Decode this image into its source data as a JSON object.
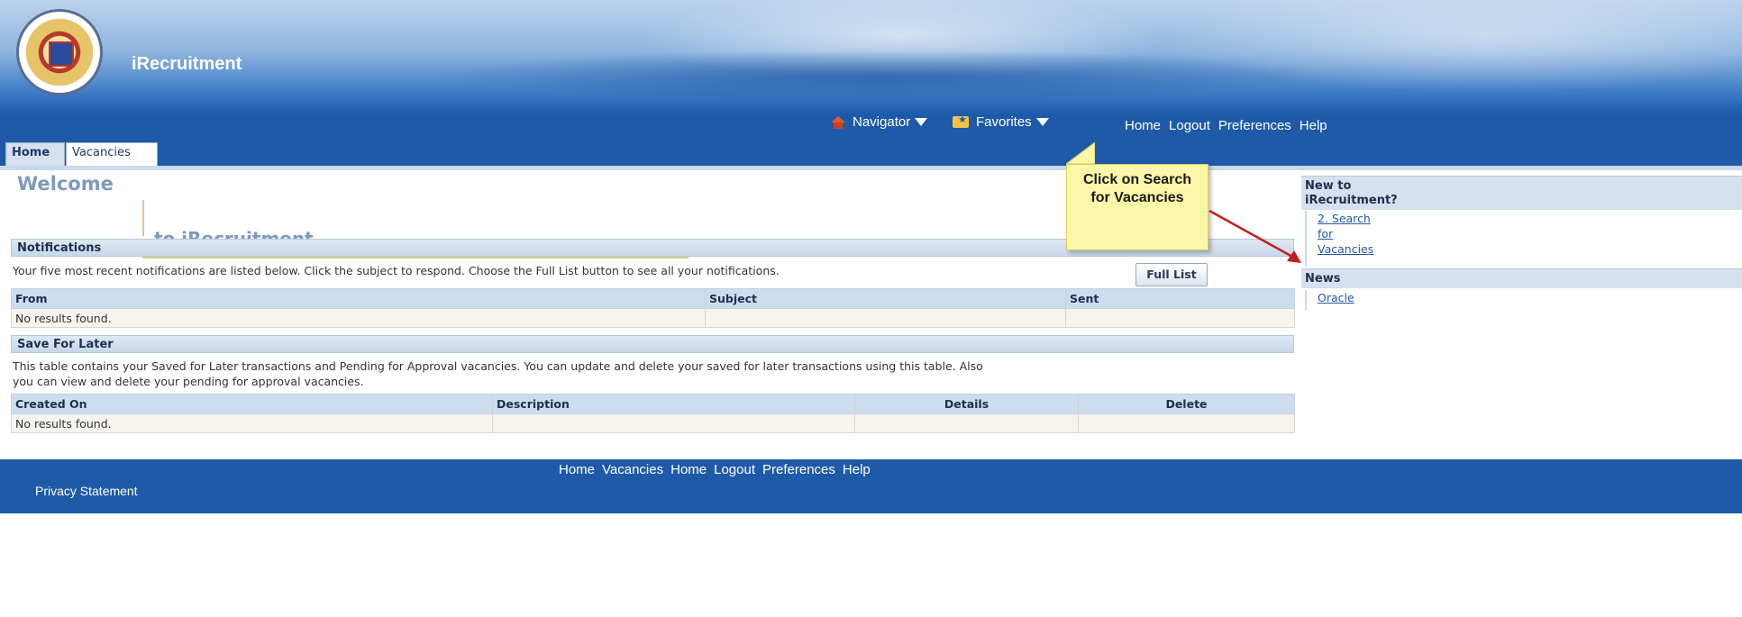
{
  "app": {
    "title": "iRecruitment"
  },
  "header": {
    "navigator_label": "Navigator",
    "favorites_label": "Favorites",
    "global_links": [
      "Home",
      "Logout",
      "Preferences",
      "Help"
    ]
  },
  "tabs": [
    {
      "label": "Home",
      "selected": true
    },
    {
      "label": "Vacancies",
      "selected": false
    }
  ],
  "welcome": {
    "title": "Welcome",
    "subtitle": "to iRecruitment"
  },
  "notifications": {
    "header": "Notifications",
    "instruction": "Your five most recent notifications are listed below. Click the subject to respond. Choose the Full List button to see all your notifications.",
    "full_list_button": "Full List",
    "columns": [
      "From",
      "Subject",
      "Sent"
    ],
    "empty_text": "No results found."
  },
  "save_for_later": {
    "header": "Save For Later",
    "instruction_line1": "This table contains your Saved for Later transactions and Pending for Approval vacancies. You can update and delete your saved for later transactions using this table. Also",
    "instruction_line2": "you can view and delete your pending for approval vacancies.",
    "columns": [
      "Created On",
      "Description",
      "Details",
      "Delete"
    ],
    "empty_text": "No results found."
  },
  "callout": {
    "line1": "Click on Search",
    "line2": "for Vacancies"
  },
  "right_panel": {
    "new_header_line1": "New to",
    "new_header_line2": "iRecruitment?",
    "search_link_lines": [
      "2. Search",
      "for",
      "Vacancies"
    ],
    "news_header": "News",
    "news_link": "Oracle"
  },
  "footer": {
    "links": [
      "Home",
      "Vacancies",
      "Home",
      "Logout",
      "Preferences",
      "Help"
    ],
    "privacy": "Privacy Statement"
  },
  "colors": {
    "brand_blue": "#1e5aa8",
    "accent_text": "#7d9abd",
    "callout_fill": "#fcf6a8",
    "arrow": "#c0201a"
  }
}
